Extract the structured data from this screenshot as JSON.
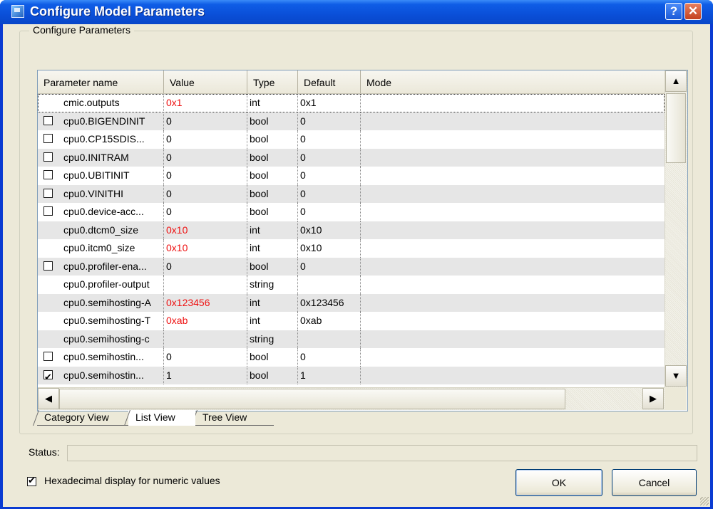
{
  "window": {
    "title": "Configure Model Parameters",
    "help_label": "?",
    "close_label": "✕"
  },
  "group": {
    "title": "Configure Parameters"
  },
  "table": {
    "headers": [
      "Parameter name",
      "Value",
      "Type",
      "Default",
      "Mode"
    ],
    "rows": [
      {
        "name": "cmic.outputs",
        "value": "0x1",
        "type": "int",
        "default": "0x1",
        "checkbox": "none",
        "highlight": true
      },
      {
        "name": "cpu0.BIGENDINIT",
        "value": "0",
        "type": "bool",
        "default": "0",
        "checkbox": "unchecked",
        "highlight": false
      },
      {
        "name": "cpu0.CP15SDIS...",
        "value": "0",
        "type": "bool",
        "default": "0",
        "checkbox": "unchecked",
        "highlight": false
      },
      {
        "name": "cpu0.INITRAM",
        "value": "0",
        "type": "bool",
        "default": "0",
        "checkbox": "unchecked",
        "highlight": false
      },
      {
        "name": "cpu0.UBITINIT",
        "value": "0",
        "type": "bool",
        "default": "0",
        "checkbox": "unchecked",
        "highlight": false
      },
      {
        "name": "cpu0.VINITHI",
        "value": "0",
        "type": "bool",
        "default": "0",
        "checkbox": "unchecked",
        "highlight": false
      },
      {
        "name": "cpu0.device-acc...",
        "value": "0",
        "type": "bool",
        "default": "0",
        "checkbox": "unchecked",
        "highlight": false
      },
      {
        "name": "cpu0.dtcm0_size",
        "value": "0x10",
        "type": "int",
        "default": "0x10",
        "checkbox": "none",
        "highlight": true
      },
      {
        "name": "cpu0.itcm0_size",
        "value": "0x10",
        "type": "int",
        "default": "0x10",
        "checkbox": "none",
        "highlight": true
      },
      {
        "name": "cpu0.profiler-ena...",
        "value": "0",
        "type": "bool",
        "default": "0",
        "checkbox": "unchecked",
        "highlight": false
      },
      {
        "name": "cpu0.profiler-output",
        "value": "",
        "type": "string",
        "default": "",
        "checkbox": "none",
        "highlight": false
      },
      {
        "name": "cpu0.semihosting-A",
        "value": "0x123456",
        "type": "int",
        "default": "0x123456",
        "checkbox": "none",
        "highlight": true
      },
      {
        "name": "cpu0.semihosting-T",
        "value": "0xab",
        "type": "int",
        "default": "0xab",
        "checkbox": "none",
        "highlight": true
      },
      {
        "name": "cpu0.semihosting-c",
        "value": "",
        "type": "string",
        "default": "",
        "checkbox": "none",
        "highlight": false
      },
      {
        "name": "cpu0.semihostin...",
        "value": "0",
        "type": "bool",
        "default": "0",
        "checkbox": "unchecked",
        "highlight": false
      },
      {
        "name": "cpu0.semihostin...",
        "value": "1",
        "type": "bool",
        "default": "1",
        "checkbox": "checked",
        "highlight": false
      }
    ]
  },
  "scroll": {
    "up": "▲",
    "down": "▼",
    "left": "◀",
    "right": "▶"
  },
  "tabs": [
    "Category View",
    "List View",
    "Tree View"
  ],
  "status": {
    "label": "Status:",
    "value": ""
  },
  "options": {
    "hex_label": "Hexadecimal display for numeric values",
    "hex_checked": true
  },
  "buttons": {
    "ok": "OK",
    "cancel": "Cancel"
  },
  "colors": {
    "title_blue": "#0a4fd8",
    "changed_value": "#e11111",
    "face": "#ece9d8"
  }
}
